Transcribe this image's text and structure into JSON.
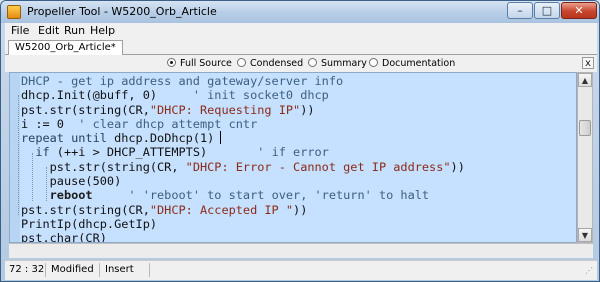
{
  "window": {
    "title": "Propeller Tool - W5200_Orb_Article",
    "minimize_glyph": "–",
    "maximize_glyph": "□",
    "close_glyph": "✕"
  },
  "menu": {
    "items": [
      "File",
      "Edit",
      "Run",
      "Help"
    ]
  },
  "tabs": [
    {
      "label": "W5200_Orb_Article*"
    }
  ],
  "view_modes": {
    "options": [
      "Full Source",
      "Condensed",
      "Summary",
      "Documentation"
    ],
    "selected": "Full Source"
  },
  "editor": {
    "pane_close_glyph": "x",
    "lines": [
      {
        "segments": [
          {
            "t": "DHCP - get ip address and gateway/server info",
            "c": "cmt"
          }
        ]
      },
      {
        "segments": [
          {
            "t": "dhcp.Init(@buff, 0)",
            "c": ""
          },
          {
            "t": "     ' init socket0 dhcp",
            "c": "cmt"
          }
        ]
      },
      {
        "segments": [
          {
            "t": "pst.str(string(CR,",
            "c": ""
          },
          {
            "t": "\"DHCP: Requesting IP\"",
            "c": "str"
          },
          {
            "t": "))",
            "c": ""
          }
        ]
      },
      {
        "segments": [
          {
            "t": "i := 0",
            "c": ""
          },
          {
            "t": "  ' clear dhcp attempt cntr",
            "c": "cmt"
          }
        ]
      },
      {
        "segments": [
          {
            "t": "repeat until ",
            "c": "ctl"
          },
          {
            "t": "dhcp.DoDhcp(1)",
            "c": ""
          }
        ]
      },
      {
        "segments": [
          {
            "t": "  if ",
            "c": "ctl"
          },
          {
            "t": "(++i > DHCP_ATTEMPTS)",
            "c": ""
          },
          {
            "t": "       ' if error",
            "c": "cmt"
          }
        ]
      },
      {
        "segments": [
          {
            "t": "    pst.str(string(CR, ",
            "c": ""
          },
          {
            "t": "\"DHCP: Error - Cannot get IP address\"",
            "c": "str"
          },
          {
            "t": "))",
            "c": ""
          }
        ]
      },
      {
        "segments": [
          {
            "t": "    pause(500)",
            "c": ""
          }
        ]
      },
      {
        "segments": [
          {
            "t": "    reboot",
            "c": "kw"
          },
          {
            "t": "     ' 'reboot' to start over, 'return' to halt",
            "c": "cmt"
          }
        ]
      },
      {
        "segments": [
          {
            "t": "pst.str(string(CR,",
            "c": ""
          },
          {
            "t": "\"DHCP: Accepted IP \"",
            "c": "str"
          },
          {
            "t": "))",
            "c": ""
          }
        ]
      },
      {
        "segments": [
          {
            "t": "PrintIp(dhcp.GetIp)",
            "c": ""
          }
        ]
      },
      {
        "segments": [
          {
            "t": "pst.char(CR)",
            "c": ""
          }
        ]
      }
    ]
  },
  "scroll": {
    "up_glyph": "▲",
    "down_glyph": "▼"
  },
  "status": {
    "position": "72 : 32",
    "state": "Modified",
    "mode": "Insert"
  }
}
